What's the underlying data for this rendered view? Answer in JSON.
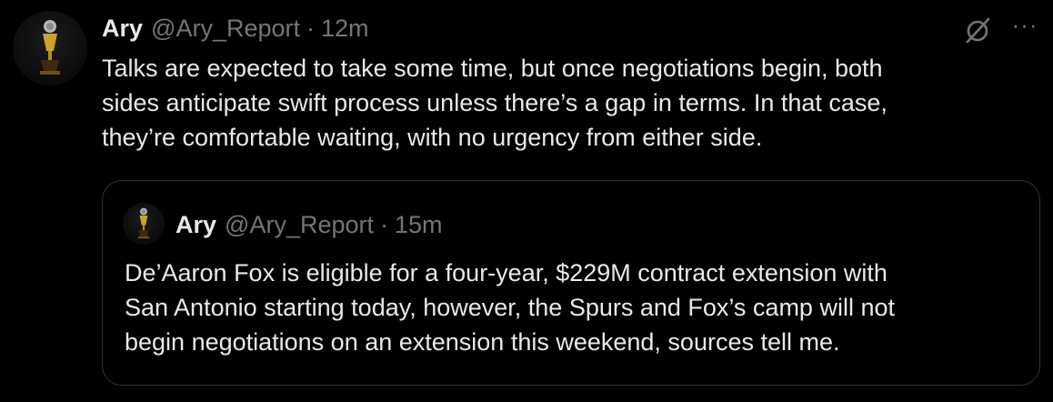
{
  "tweet": {
    "author_name": "Ary",
    "author_handle": "@Ary_Report",
    "separator": "·",
    "time": "12m",
    "text": "Talks are expected to take some time, but once negotiations begin, both\nsides anticipate swift process unless there’s a gap in terms. In that case,\nthey’re comfortable waiting, with no urgency from either side."
  },
  "quoted_tweet": {
    "author_name": "Ary",
    "author_handle": "@Ary_Report",
    "separator": "·",
    "time": "15m",
    "text": "De’Aaron Fox is eligible for a four-year, $229M contract extension with\nSan Antonio starting today, however, the Spurs and Fox’s camp will not\nbegin negotiations on an extension this weekend, sources tell me."
  },
  "actions": {
    "grok_icon": "grok-slash-icon",
    "more_label": "···"
  },
  "colors": {
    "background": "#000000",
    "primary_text": "#e7e9ea",
    "secondary_text": "#71767b",
    "border": "#2f3336",
    "trophy_gold": "#c9a227"
  }
}
